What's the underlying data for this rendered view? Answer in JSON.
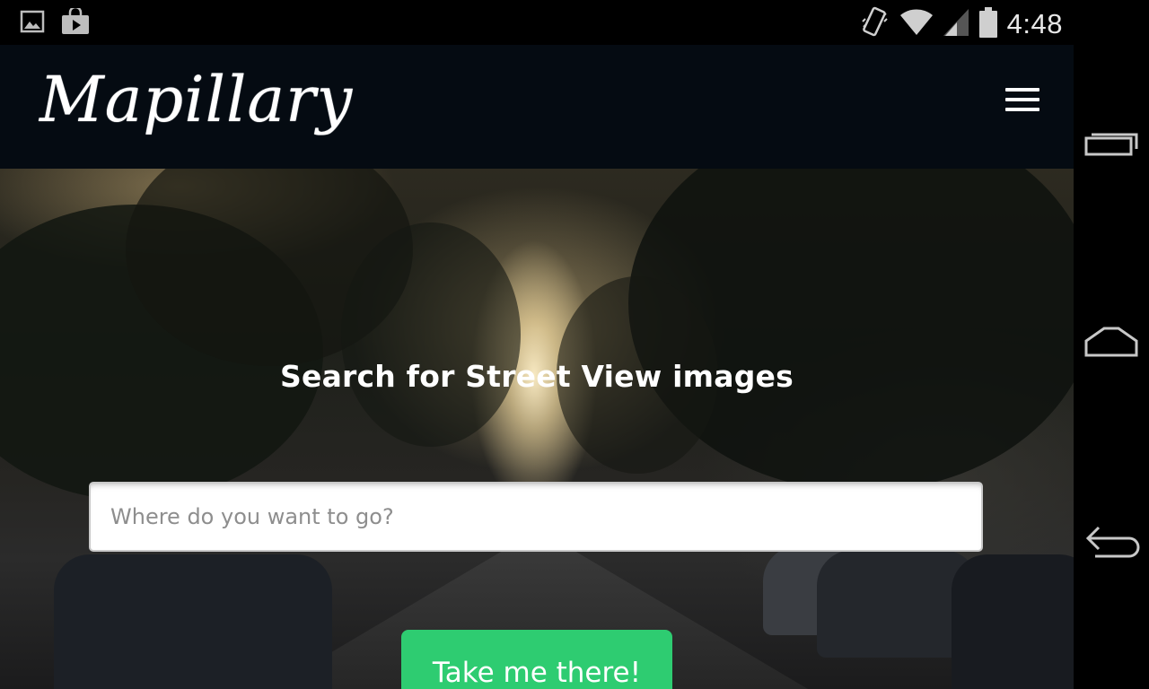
{
  "status_bar": {
    "time": "4:48",
    "left_icons": [
      "image-notification-icon",
      "play-store-notification-icon"
    ],
    "right_icons": [
      "vibrate-icon",
      "wifi-icon",
      "cell-signal-icon",
      "battery-icon"
    ]
  },
  "header": {
    "logo_text": "Mapillary",
    "background_color": "#050b12",
    "menu_icon": "hamburger-menu-icon"
  },
  "hero": {
    "title": "Search for Street View images",
    "search": {
      "placeholder": "Where do you want to go?",
      "value": ""
    },
    "button_label": "Take me there!",
    "button_color": "#2ecc71"
  },
  "nav_bar": {
    "buttons": [
      "recent-apps-icon",
      "home-icon",
      "back-icon"
    ]
  }
}
